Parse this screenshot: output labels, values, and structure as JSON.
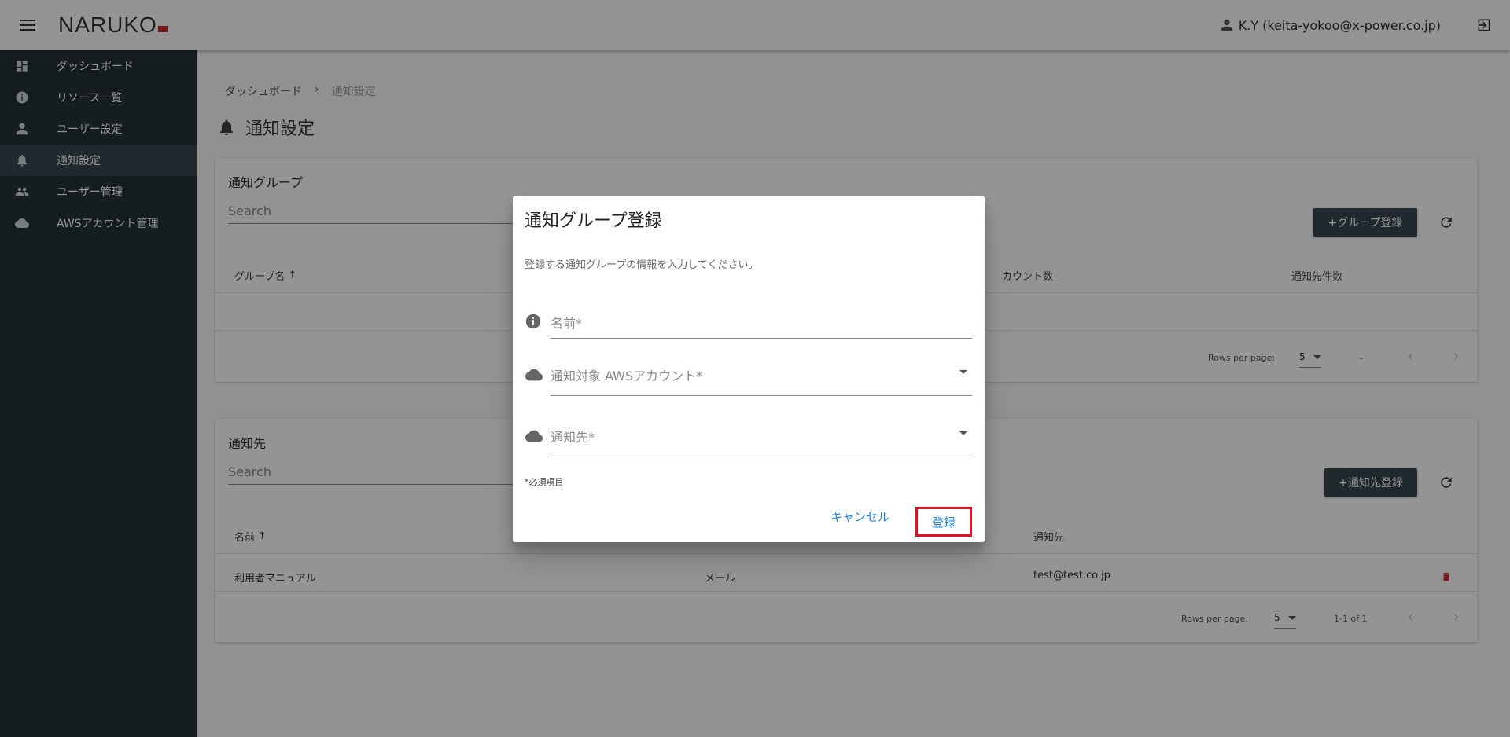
{
  "app": {
    "logo": "NARUKO"
  },
  "header": {
    "user": "K.Y (keita-yokoo@x-power.co.jp)"
  },
  "sidebar": {
    "items": [
      {
        "label": "ダッシュボード",
        "icon": "dashboard-icon"
      },
      {
        "label": "リソース一覧",
        "icon": "info-icon"
      },
      {
        "label": "ユーザー設定",
        "icon": "person-icon"
      },
      {
        "label": "通知設定",
        "icon": "bell-icon",
        "active": true
      },
      {
        "label": "ユーザー管理",
        "icon": "people-icon"
      },
      {
        "label": "AWSアカウント管理",
        "icon": "cloud-icon"
      }
    ]
  },
  "breadcrumb": {
    "home": "ダッシュボード",
    "separator": "›",
    "current": "通知設定"
  },
  "page": {
    "title": "通知設定"
  },
  "groups_card": {
    "title": "通知グループ",
    "search_placeholder": "Search",
    "add_button": "+グループ登録",
    "columns": {
      "name": "グループ名",
      "accounts": "カウント数",
      "destinations": "通知先件数"
    },
    "sort_arrow": "↑",
    "footer": {
      "rows_per_page_label": "Rows per page:",
      "rows_per_page": "5",
      "range": "–"
    }
  },
  "destinations_card": {
    "title": "通知先",
    "search_placeholder": "Search",
    "add_button": "+通知先登録",
    "columns": {
      "name": "名前",
      "destination": "通知先"
    },
    "sort_arrow": "↑",
    "rows": [
      {
        "name": "利用者マニュアル",
        "type": "メール",
        "destination": "test@test.co.jp"
      }
    ],
    "footer": {
      "rows_per_page_label": "Rows per page:",
      "rows_per_page": "5",
      "range": "1-1 of 1"
    }
  },
  "dialog": {
    "title": "通知グループ登録",
    "description": "登録する通知グループの情報を入力してください。",
    "fields": {
      "name": "名前*",
      "aws_account": "通知対象 AWSアカウント*",
      "destination": "通知先*"
    },
    "required_note": "*必須項目",
    "cancel": "キャンセル",
    "submit": "登録"
  },
  "colors": {
    "sidebar": "#263238",
    "primary_button": "#37474f",
    "link": "#1e88e5",
    "highlight": "#e0141e",
    "danger": "#d32f2f"
  }
}
